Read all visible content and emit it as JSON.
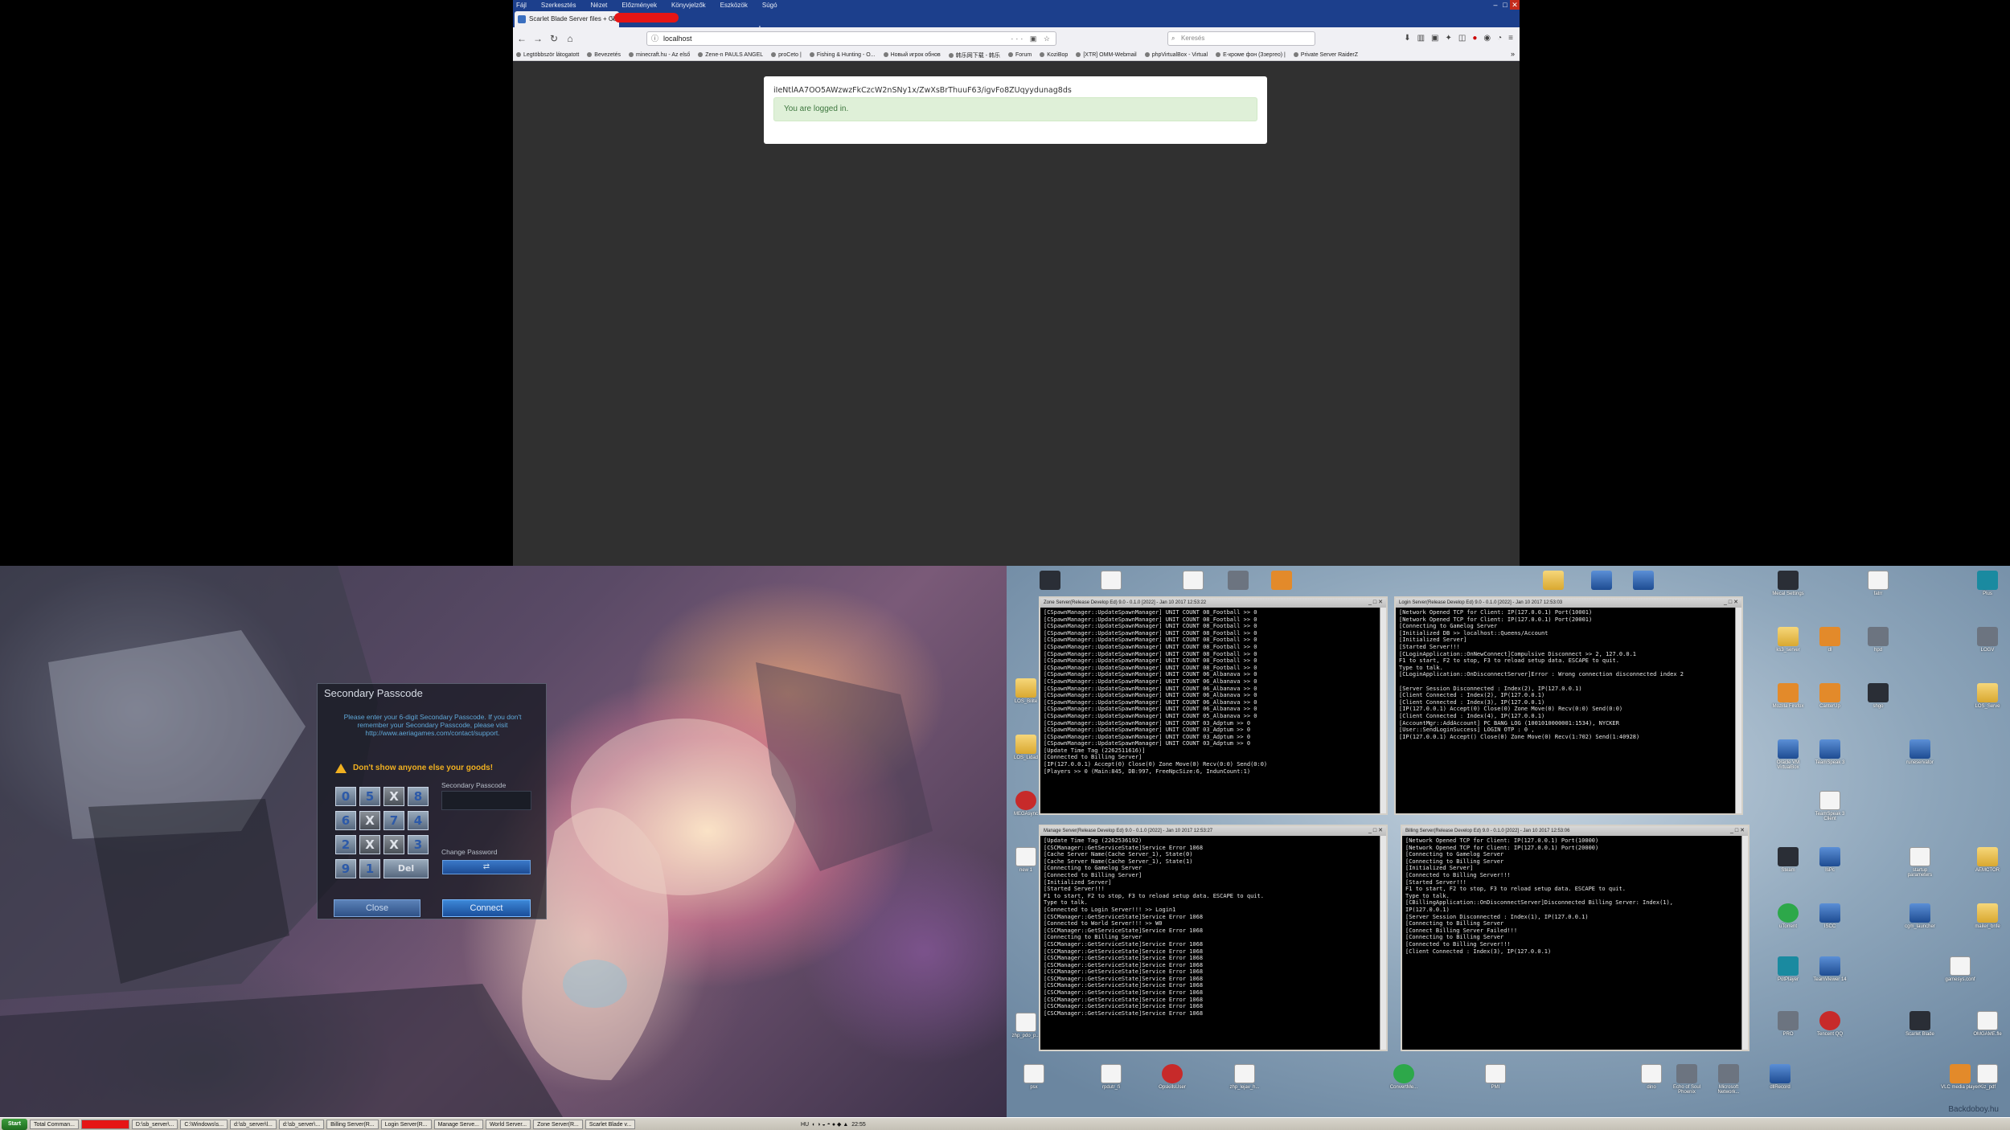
{
  "browser": {
    "menu": [
      "Fájl",
      "Szerkesztés",
      "Nézet",
      "Előzmények",
      "Könyvjelzők",
      "Eszközök",
      "Súgó"
    ],
    "tab_title": "Scarlet Blade Server files + Client",
    "url": "localhost",
    "search_placeholder": "Keresés",
    "bookmarks": [
      "Legtöbbször látogatott",
      "Bevezetés",
      "minecraft.hu - Az első",
      "Zene-n PAULS ANGEL",
      "proCeto |",
      "Fishing & Hunting - O...",
      "Новый игрок обнов",
      "韩乐网下载 - 韩乐",
      "Forum",
      "KoziBop",
      "[XTR] OMM-Webmail",
      "phpVirtualBox - Virtual",
      "E-кроме фон (Ззергео) |",
      "Private Server RaiderZ"
    ],
    "token": "iIeNtlAA7OO5AWzwzFkCzcW2nSNy1x/ZwXsBrThuuF63/igvFo8ZUqyydunag8ds",
    "alert": "You are logged in."
  },
  "game": {
    "title": "Secondary Passcode",
    "desc": [
      "Please enter your 6-digit Secondary Passcode. If you don't",
      "remember your Secondary Passcode, please visit",
      "http://www.aeriagames.com/contact/support."
    ],
    "warning": "Don't show anyone else your goods!",
    "passcode_label": "Secondary Passcode",
    "change_label": "Change Password",
    "keys": [
      "0",
      "5",
      "X",
      "8",
      "6",
      "X",
      "7",
      "4",
      "2",
      "X",
      "X",
      "3",
      "9",
      "1",
      "Del"
    ],
    "close": "Close",
    "connect": "Connect"
  },
  "consoles": [
    {
      "title": "Zone Server(Release Develop Ed) 9.0 - 0.1.0 [2022] - Jan 10 2017 12:53:22",
      "lines": [
        "[CSpawnManager::UpdateSpawnManager] UNIT COUNT 08_Football >> 0",
        "[CSpawnManager::UpdateSpawnManager] UNIT COUNT 08_Football >> 0",
        "[CSpawnManager::UpdateSpawnManager] UNIT COUNT 08_Football >> 0",
        "[CSpawnManager::UpdateSpawnManager] UNIT COUNT 08_Football >> 0",
        "[CSpawnManager::UpdateSpawnManager] UNIT COUNT 08_Football >> 0",
        "[CSpawnManager::UpdateSpawnManager] UNIT COUNT 08_Football >> 0",
        "[CSpawnManager::UpdateSpawnManager] UNIT COUNT 08_Football >> 0",
        "[CSpawnManager::UpdateSpawnManager] UNIT COUNT 08_Football >> 0",
        "[CSpawnManager::UpdateSpawnManager] UNIT COUNT 08_Football >> 0",
        "[CSpawnManager::UpdateSpawnManager] UNIT COUNT 06_Albanava >> 0",
        "[CSpawnManager::UpdateSpawnManager] UNIT COUNT 06_Albanava >> 0",
        "[CSpawnManager::UpdateSpawnManager] UNIT COUNT 06_Albanava >> 0",
        "[CSpawnManager::UpdateSpawnManager] UNIT COUNT 06_Albanava >> 0",
        "[CSpawnManager::UpdateSpawnManager] UNIT COUNT 06_Albanava >> 0",
        "[CSpawnManager::UpdateSpawnManager] UNIT COUNT 06_Albanava >> 0",
        "[CSpawnManager::UpdateSpawnManager] UNIT COUNT 05_Albanava >> 0",
        "[CSpawnManager::UpdateSpawnManager] UNIT COUNT 03_Adptum >> 0",
        "[CSpawnManager::UpdateSpawnManager] UNIT COUNT 03_Adptum >> 0",
        "[CSpawnManager::UpdateSpawnManager] UNIT COUNT 03_Adptum >> 0",
        "[CSpawnManager::UpdateSpawnManager] UNIT COUNT 03_Adptum >> 0",
        "[Update Time Tag (2262511616)]",
        "[Connected to Billing Server]",
        "[IP(127.0.0.1) Accept(0) Close(0) Zone Move(0) Recv(0:0) Send(0:0)",
        "[Players >> 0 (Main:845, DB:997, FreeNpcSize:6, IndunCount:1)"
      ]
    },
    {
      "title": "Login Server(Release Develop Ed) 9.0 - 0.1.0 [2022] - Jan 10 2017 12:53:03",
      "lines": [
        "[Network Opened TCP for Client: IP(127.0.0.1) Port(10001)",
        "[Network Opened TCP for Client: IP(127.0.0.1) Port(20001)",
        "[Connecting to Gamelog Server",
        "[Initialized DB >> localhost::Queens/Account",
        "[Initialized Server]",
        "[Started Server!!!",
        "[CLoginApplication::OnNewConnect]Compulsive Disconnect >> 2, 127.0.0.1",
        "F1 to start, F2 to stop, F3 to reload setup data. ESCAPE to quit.",
        "Type to talk.",
        "[CLoginApplication::OnDisconnectServer]Error : Wrong connection disconnected index 2",
        "",
        "[Server Session Disconnected : Index(2), IP(127.0.0.1)",
        "[Client Connected : Index(2), IP(127.0.0.1)",
        "[Client Connected : Index(3), IP(127.0.0.1)",
        "[IP(127.0.0.1) Accept(0) Close(0) Zone Move(0) Recv(0:0) Send(0:0)",
        "[Client Connected : Index(4), IP(127.0.0.1)",
        "[AccountMgr::AddAccount] PC BANG LOG (1001010000001:1534), NYCKER",
        "[User::SendLoginSuccess] LOGIN OTP : 0 ,",
        "[IP(127.0.0.1) Accept() Close(0) Zone Move(0) Recv(1:702) Send(1:40928)"
      ]
    },
    {
      "title": "Manage Server(Release Develop Ed) 9.0 - 0.1.0 [2022] - Jan 10 2017 12:53:27",
      "lines": [
        "[Update Time Tag (2262536192)",
        "[CSCManager::GetServiceState]Service Error 1068",
        "[Cache Server Name(Cache Server_1), State(0)",
        "[Cache Server Name(Cache Server_1), State(1)",
        "[Connecting to Gamelog Server",
        "[Connected to Billing Server]",
        "[Initialized Server]",
        "[Started Server!!!",
        "F1 to start, F2 to stop, F3 to reload setup data. ESCAPE to quit.",
        "Type to talk.",
        "[Connected to Login Server!!! >> Login1",
        "[CSCManager::GetServiceState]Service Error 1068",
        "[Connected to World Server!!! >> W0",
        "[CSCManager::GetServiceState]Service Error 1068",
        "[Connecting to Billing Server",
        "[CSCManager::GetServiceState]Service Error 1068",
        "[CSCManager::GetServiceState]Service Error 1068",
        "[CSCManager::GetServiceState]Service Error 1068",
        "[CSCManager::GetServiceState]Service Error 1068",
        "[CSCManager::GetServiceState]Service Error 1068",
        "[CSCManager::GetServiceState]Service Error 1068",
        "[CSCManager::GetServiceState]Service Error 1068",
        "[CSCManager::GetServiceState]Service Error 1068",
        "[CSCManager::GetServiceState]Service Error 1068",
        "[CSCManager::GetServiceState]Service Error 1068",
        "[CSCManager::GetServiceState]Service Error 1068"
      ]
    },
    {
      "title": "Billing Server(Release Develop Ed) 9.0 - 0.1.0 [2022] - Jan 10 2017 12:53:06",
      "lines": [
        "[Network Opened TCP for Client: IP(127.0.0.1) Port(10000)",
        "[Network Opened TCP for Client: IP(127.0.0.1) Port(20000)",
        "[Connecting to Gamelog Server",
        "[Connecting to Billing Server",
        "[Initialized Server]",
        "[Connected to Billing Server!!!",
        "[Started Server!!!",
        "F1 to start, F2 to stop, F3 to reload setup data. ESCAPE to quit.",
        "Type to talk.",
        "[CBillingApplication::OnDisconnectServer]Disconnected Billing Server: Index(1),",
        "IP(127.0.0.1)",
        "[Server Session Disconnected : Index(1), IP(127.0.0.1)",
        "[Connecting to Billing Server",
        "[Connect Billing Server Failed!!!",
        "[Connecting to Billing Server",
        "[Connected to Billing Server!!!",
        "[Client Connected : Index(3), IP(127.0.0.1)"
      ]
    }
  ],
  "desktop": {
    "icons_left": [
      "LOS_Bilite",
      "LOS_Lidad",
      "MEGAsync",
      "new 1",
      "zhp_pdo_p..."
    ],
    "icons_bottom": [
      "psx",
      "rpdutr_fi",
      "OpskillsUser",
      "zhp_lejav_h...",
      "ConvertMe...",
      "PMI",
      "dino",
      "Echo of Soul Phoenix",
      "Microsoft Network...",
      "dllRecord"
    ],
    "icons_right1": [
      "Mecal Settings",
      "ks3_server",
      "Mozilla Firefox",
      "Oracle VM VirtualBox",
      "Steam",
      "uTorrent",
      "PotPlayer",
      "PRO",
      "Sca..."
    ],
    "icons_right2": [
      "dl",
      "CanterUp",
      "TeamSpeak 3",
      "TeamSpeak 3 Client",
      "IsPc",
      "ISCC",
      "TeamViewer 14",
      "Tencent QQ"
    ],
    "icons_right3": [
      "fatrr",
      "hpd",
      "shgo",
      "runeservator",
      "startup parameters",
      "cgm_launcher",
      "gamesys.conf",
      "Scarlet Blade",
      "VLC media player"
    ],
    "icons_right4": [
      "Plus",
      "LOGV",
      "LOS_Serve",
      "AEMCTOR",
      "mailer_bnfe",
      "OMGAME.fle",
      "Kiz_pdf"
    ],
    "watermark": "Backdoboy.hu"
  },
  "taskbar": {
    "start": "Start",
    "items": [
      "Total Comman...",
      "",
      "D:\\sb_server\\...",
      "C:\\Windows\\s...",
      "d:\\sb_server\\l...",
      "d:\\sb_server\\...",
      "Billing Server(R...",
      "Login Server(R...",
      "Manage Serve...",
      "World Server...",
      "Zone Server(R...",
      "Scarlet Blade v..."
    ],
    "lang": "HU",
    "clock": "22:55"
  }
}
